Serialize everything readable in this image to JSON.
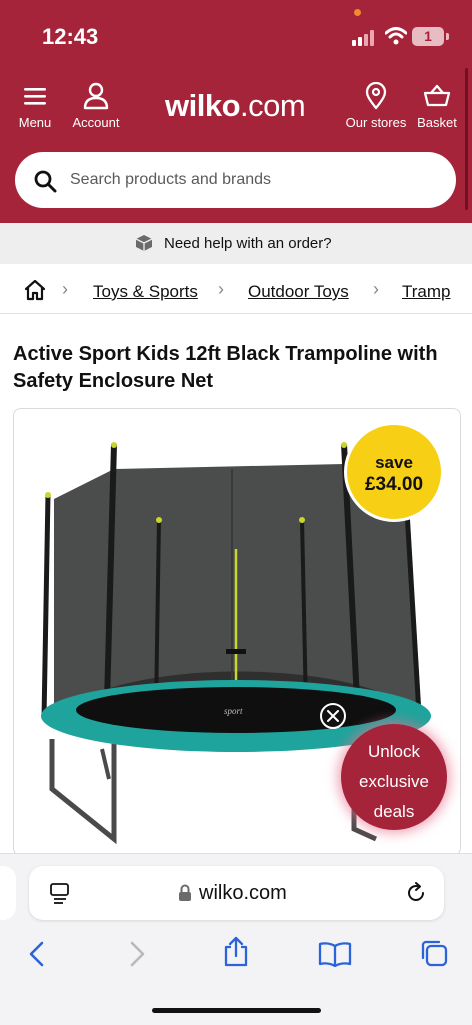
{
  "status_bar": {
    "time": "12:43",
    "battery": "1"
  },
  "header": {
    "menu_label": "Menu",
    "account_label": "Account",
    "logo_brand": "wilko",
    "logo_suffix": ".com",
    "stores_label": "Our stores",
    "basket_label": "Basket",
    "background_color": "#a6243a"
  },
  "search": {
    "placeholder": "Search products and brands"
  },
  "help": {
    "text": "Need help with an order?"
  },
  "breadcrumb": {
    "items": [
      "Toys & Sports",
      "Outdoor Toys",
      "Tramp"
    ]
  },
  "product": {
    "title": "Active Sport Kids 12ft Black Trampoline with Safety Enclosure Net",
    "save_label": "save",
    "save_amount": "£34.00",
    "image_brand": "sport",
    "unlock_lines": [
      "Unlock",
      "exclusive",
      "deals"
    ]
  },
  "browser": {
    "url": "wilko.com"
  },
  "icons": {
    "menu": "hamburger-icon",
    "account": "user-icon",
    "stores": "location-pin-icon",
    "basket": "basket-icon",
    "search": "magnifier-icon",
    "help": "package-icon",
    "home": "home-icon",
    "close": "close-icon",
    "reader": "reader-icon",
    "lock": "lock-icon",
    "reload": "reload-icon",
    "back": "back-arrow-icon",
    "forward": "forward-arrow-icon",
    "share": "share-icon",
    "bookmarks": "bookmarks-icon",
    "tabs": "tabs-icon"
  }
}
